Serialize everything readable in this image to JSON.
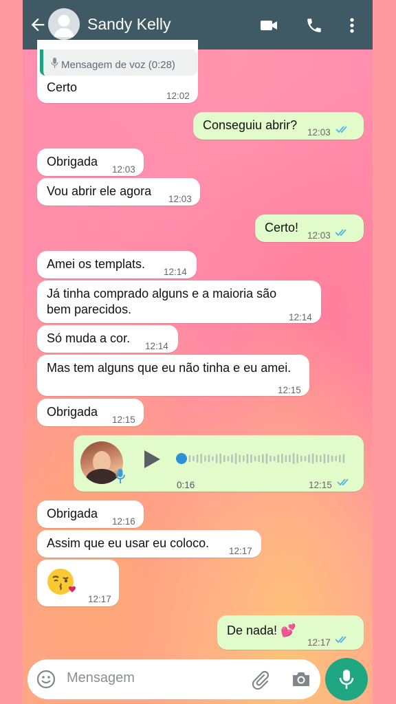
{
  "header": {
    "contact_name": "Sandy Kelly",
    "icons": [
      "back-arrow-icon",
      "video-call-icon",
      "phone-icon",
      "more-vert-icon"
    ]
  },
  "messages": [
    {
      "dir": "in",
      "quoted_label": "Mensagem de voz (0:28)",
      "text": "Certo",
      "time": "12:02"
    },
    {
      "dir": "out",
      "text": "Conseguiu abrir?",
      "time": "12:03",
      "status": "read"
    },
    {
      "dir": "in",
      "text": "Obrigada",
      "time": "12:03"
    },
    {
      "dir": "in",
      "text": "Vou abrir ele agora",
      "time": "12:03"
    },
    {
      "dir": "out",
      "text": "Certo!",
      "time": "12:03",
      "status": "read"
    },
    {
      "dir": "in",
      "text": "Amei os templats.",
      "time": "12:14"
    },
    {
      "dir": "in",
      "text_line1": "Já tinha comprado alguns e a maioria são",
      "text_line2": "bem parecidos.",
      "time": "12:14"
    },
    {
      "dir": "in",
      "text": "Só muda a cor.",
      "time": "12:14"
    },
    {
      "dir": "in",
      "text": "Mas tem alguns que eu não tinha e eu amei.",
      "time": "12:15"
    },
    {
      "dir": "in",
      "text": "Obrigada",
      "time": "12:15"
    },
    {
      "dir": "out",
      "type": "voice",
      "position": "0:16",
      "progress": 0.0,
      "time": "12:15",
      "status": "read"
    },
    {
      "dir": "in",
      "text": "Obrigada",
      "time": "12:16"
    },
    {
      "dir": "in",
      "text": "Assim que eu usar eu coloco.",
      "time": "12:17"
    },
    {
      "dir": "in",
      "text": "😘",
      "time": "12:17"
    },
    {
      "dir": "out",
      "text": "De nada! 💕",
      "time": "12:17",
      "status": "read"
    }
  ],
  "composer": {
    "placeholder": "Mensagem",
    "icons": [
      "emoji-icon",
      "attach-icon",
      "camera-icon",
      "mic-icon"
    ]
  },
  "colors": {
    "header": "#3f5a64",
    "incoming": "#ffffff",
    "outgoing": "#e2fbcb",
    "read_tick": "#4fb6ec",
    "accent": "#1fa784"
  }
}
